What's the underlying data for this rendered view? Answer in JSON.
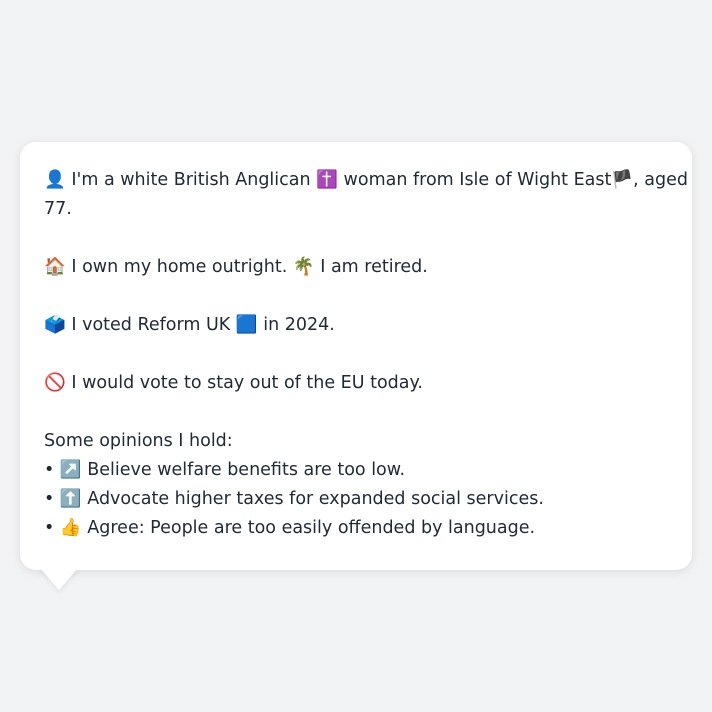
{
  "profile": {
    "identity": {
      "icon": "👤",
      "text_a": "I'm a white British Anglican",
      "icon_religion": "✝️",
      "text_b": "woman from Isle of Wight East",
      "icon_flag": "🏴",
      "text_c": ", aged",
      "text_d": "77."
    },
    "home": {
      "icon": "🏠",
      "text_a": "I own my home outright.",
      "icon_retired": "🌴",
      "text_b": "I am retired."
    },
    "vote": {
      "icon": "🗳️",
      "text_a": "I voted Reform UK",
      "icon_party": "🟦",
      "text_b": "in 2024."
    },
    "eu": {
      "icon": "🚫",
      "text": "I would vote to stay out of the EU today."
    },
    "opinions": {
      "heading": "Some opinions I hold:",
      "bullet": "•",
      "items": [
        {
          "icon": "↗️",
          "text": "Believe welfare benefits are too low."
        },
        {
          "icon": "⬆️",
          "text": "Advocate higher taxes for expanded social services."
        },
        {
          "icon": "👍",
          "text": "Agree: People are too easily offended by language."
        }
      ]
    }
  }
}
